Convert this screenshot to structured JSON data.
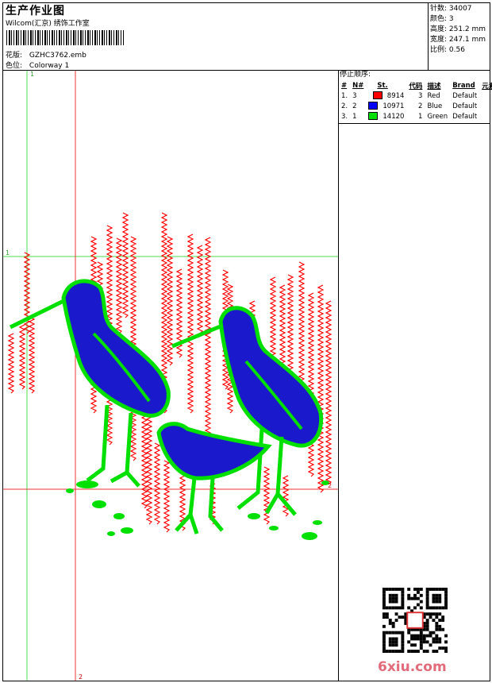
{
  "header": {
    "title": "生产作业图",
    "subtitle": "Wilcom(汇京) 绣饰工作室",
    "design_label": "花版:",
    "design_value": "GZHC3762.emb",
    "colorway_label": "色位:",
    "colorway_value": "Colorway 1"
  },
  "stats": {
    "stitches": "针数: 34007",
    "colors": "颜色: 3",
    "height": "高度: 251.2 mm",
    "width": "宽度: 247.1 mm",
    "scale": "比例: 0.56"
  },
  "sequence": {
    "heading": "停止顺序:",
    "columns": [
      "#",
      "N#",
      "St.",
      "代码",
      "描述",
      "Brand",
      "元素"
    ],
    "rows": [
      {
        "idx": "1.",
        "n": "3",
        "color": "#ff0000",
        "stitches": "8914",
        "code": "3",
        "desc": "Red",
        "brand": "Default"
      },
      {
        "idx": "2.",
        "n": "2",
        "color": "#0000ff",
        "stitches": "10971",
        "code": "2",
        "desc": "Blue",
        "brand": "Default"
      },
      {
        "idx": "3.",
        "n": "1",
        "color": "#00e000",
        "stitches": "14120",
        "code": "1",
        "desc": "Green",
        "brand": "Default"
      }
    ]
  },
  "guides": {
    "v_green_label": "1",
    "h_green_label": "1",
    "h_red_label": "2",
    "v_red_label": "2"
  },
  "colors": {
    "red": "#ff0000",
    "blue": "#0000ff",
    "green": "#00e000"
  },
  "watermark": "6xiu.com"
}
